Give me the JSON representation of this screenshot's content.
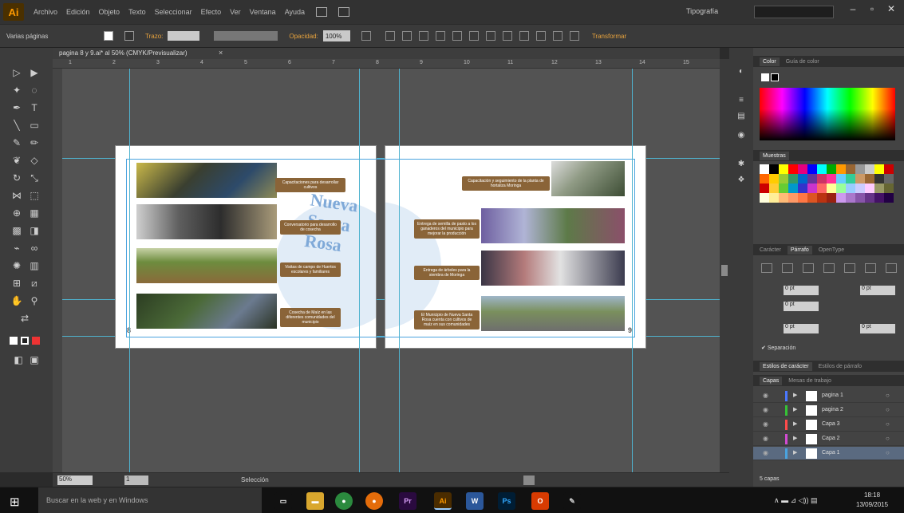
{
  "app": {
    "logo": "Ai",
    "workspace": "Tipografía",
    "window_controls": [
      "–",
      "▫",
      "✕"
    ]
  },
  "menu": [
    "Archivo",
    "Edición",
    "Objeto",
    "Texto",
    "Seleccionar",
    "Efecto",
    "Ver",
    "Ventana",
    "Ayuda"
  ],
  "control_bar": {
    "selection_label": "Varias páginas",
    "stroke_label": "Trazo:",
    "opacity_label": "Opacidad:",
    "opacity_value": "100%",
    "transform_label": "Transformar"
  },
  "document_tab": {
    "title": "pagina 8 y 9.ai* al 50% (CMYK/Previsualizar)",
    "close": "×"
  },
  "ruler_ticks": [
    "1",
    "2",
    "3",
    "4",
    "5",
    "6",
    "7",
    "8",
    "9",
    "10",
    "11",
    "12",
    "13",
    "14",
    "15"
  ],
  "artwork": {
    "watermark": "Nueva Santa Rosa",
    "page_numbers": [
      "8",
      "9"
    ],
    "left_labels": [
      "Capacitaciones para desarrollar cultivos",
      "Conversatorio para desarrollo de cosecha",
      "Visitas de campo de Huertos escolares y familiares",
      "Cosecha de Maíz en las diferentes comunidades del municipio"
    ],
    "right_labels": [
      "Capacitación y seguimiento de la planta de hortaliza Moringa",
      "Entrega de semilla de pasto a los ganaderos del municipio para mejorar la producción",
      "Entrega de árboles para la siembra de Moringa",
      "El Municipio de Nueva Santa Rosa cuenta con cultivos de maíz en sus comunidades"
    ]
  },
  "status_bar": {
    "zoom": "50%",
    "page": "1",
    "tool": "Selección"
  },
  "panels": {
    "color_tabs": [
      "Color",
      "Guía de color"
    ],
    "swatches_title": "Muestras",
    "paragraph_tabs": [
      "Carácter",
      "Párrafo",
      "OpenType"
    ],
    "paragraph_fields": [
      "0 pt",
      "0 pt",
      "0 pt",
      "0 pt",
      "0 pt"
    ],
    "hyphenation": "Separación",
    "styles_tabs": [
      "Estilos de carácter",
      "Estilos de párrafo"
    ],
    "layers_tabs": [
      "Capas",
      "Mesas de trabajo"
    ],
    "layers": [
      {
        "name": "pagina 1",
        "color": "#4a78ff"
      },
      {
        "name": "pagina 2",
        "color": "#36c236"
      },
      {
        "name": "Capa 3",
        "color": "#ff4b4b"
      },
      {
        "name": "Capa 2",
        "color": "#d24bd2"
      },
      {
        "name": "Capa 1",
        "color": "#4aa3df"
      }
    ],
    "layers_footer": "5 capas"
  },
  "taskbar": {
    "search_placeholder": "Buscar en la web y en Windows",
    "apps": [
      "Explorador",
      "Chrome",
      "Firefox",
      "Premiere",
      "Illustrator",
      "Word",
      "Photoshop",
      "Office",
      "Paint"
    ],
    "app_glyphs": [
      "▭",
      "▬",
      "●",
      "●",
      "Pr",
      "Ai",
      "W",
      "Ps",
      "O"
    ],
    "time": "18:18",
    "date": "13/09/2015",
    "tray": "∧ ▬ ⊿ ◁)) ▤"
  }
}
